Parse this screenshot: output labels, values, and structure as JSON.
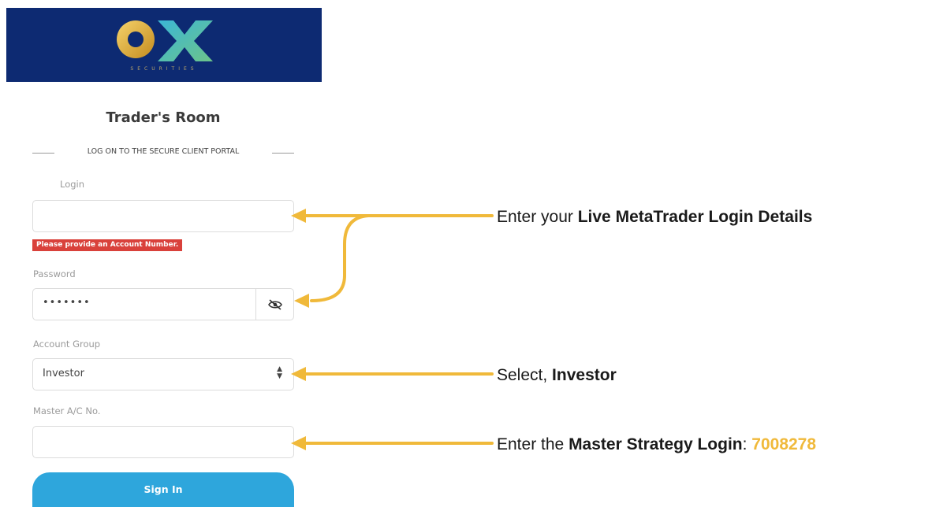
{
  "brand": {
    "logo_text": "OX",
    "logo_subtext": "SECURITIES",
    "banner_color": "#0d2a72"
  },
  "page": {
    "title": "Trader's Room",
    "subtitle": "LOG ON TO THE SECURE CLIENT PORTAL"
  },
  "form": {
    "login": {
      "label": "Login",
      "value": "",
      "error": "Please provide an Account Number."
    },
    "password": {
      "label": "Password",
      "value": "•••••••"
    },
    "account_group": {
      "label": "Account Group",
      "selected": "Investor"
    },
    "master_ac": {
      "label": "Master A/C No.",
      "value": ""
    },
    "sign_in_label": "Sign In"
  },
  "annotations": {
    "note1": {
      "prefix": "Enter your ",
      "bold": "Live MetaTrader Login Details"
    },
    "note2": {
      "prefix": "Select, ",
      "bold": "Investor"
    },
    "note3": {
      "prefix": "Enter the ",
      "bold": "Master Strategy Login",
      "sep": ": ",
      "highlight": "7008278"
    }
  },
  "colors": {
    "accent": "#2ea6dc",
    "arrow": "#f0b93a",
    "error": "#d9413b"
  },
  "icons": {
    "password_toggle": "eye-slash-icon",
    "select_caret": "updown-caret-icon"
  }
}
